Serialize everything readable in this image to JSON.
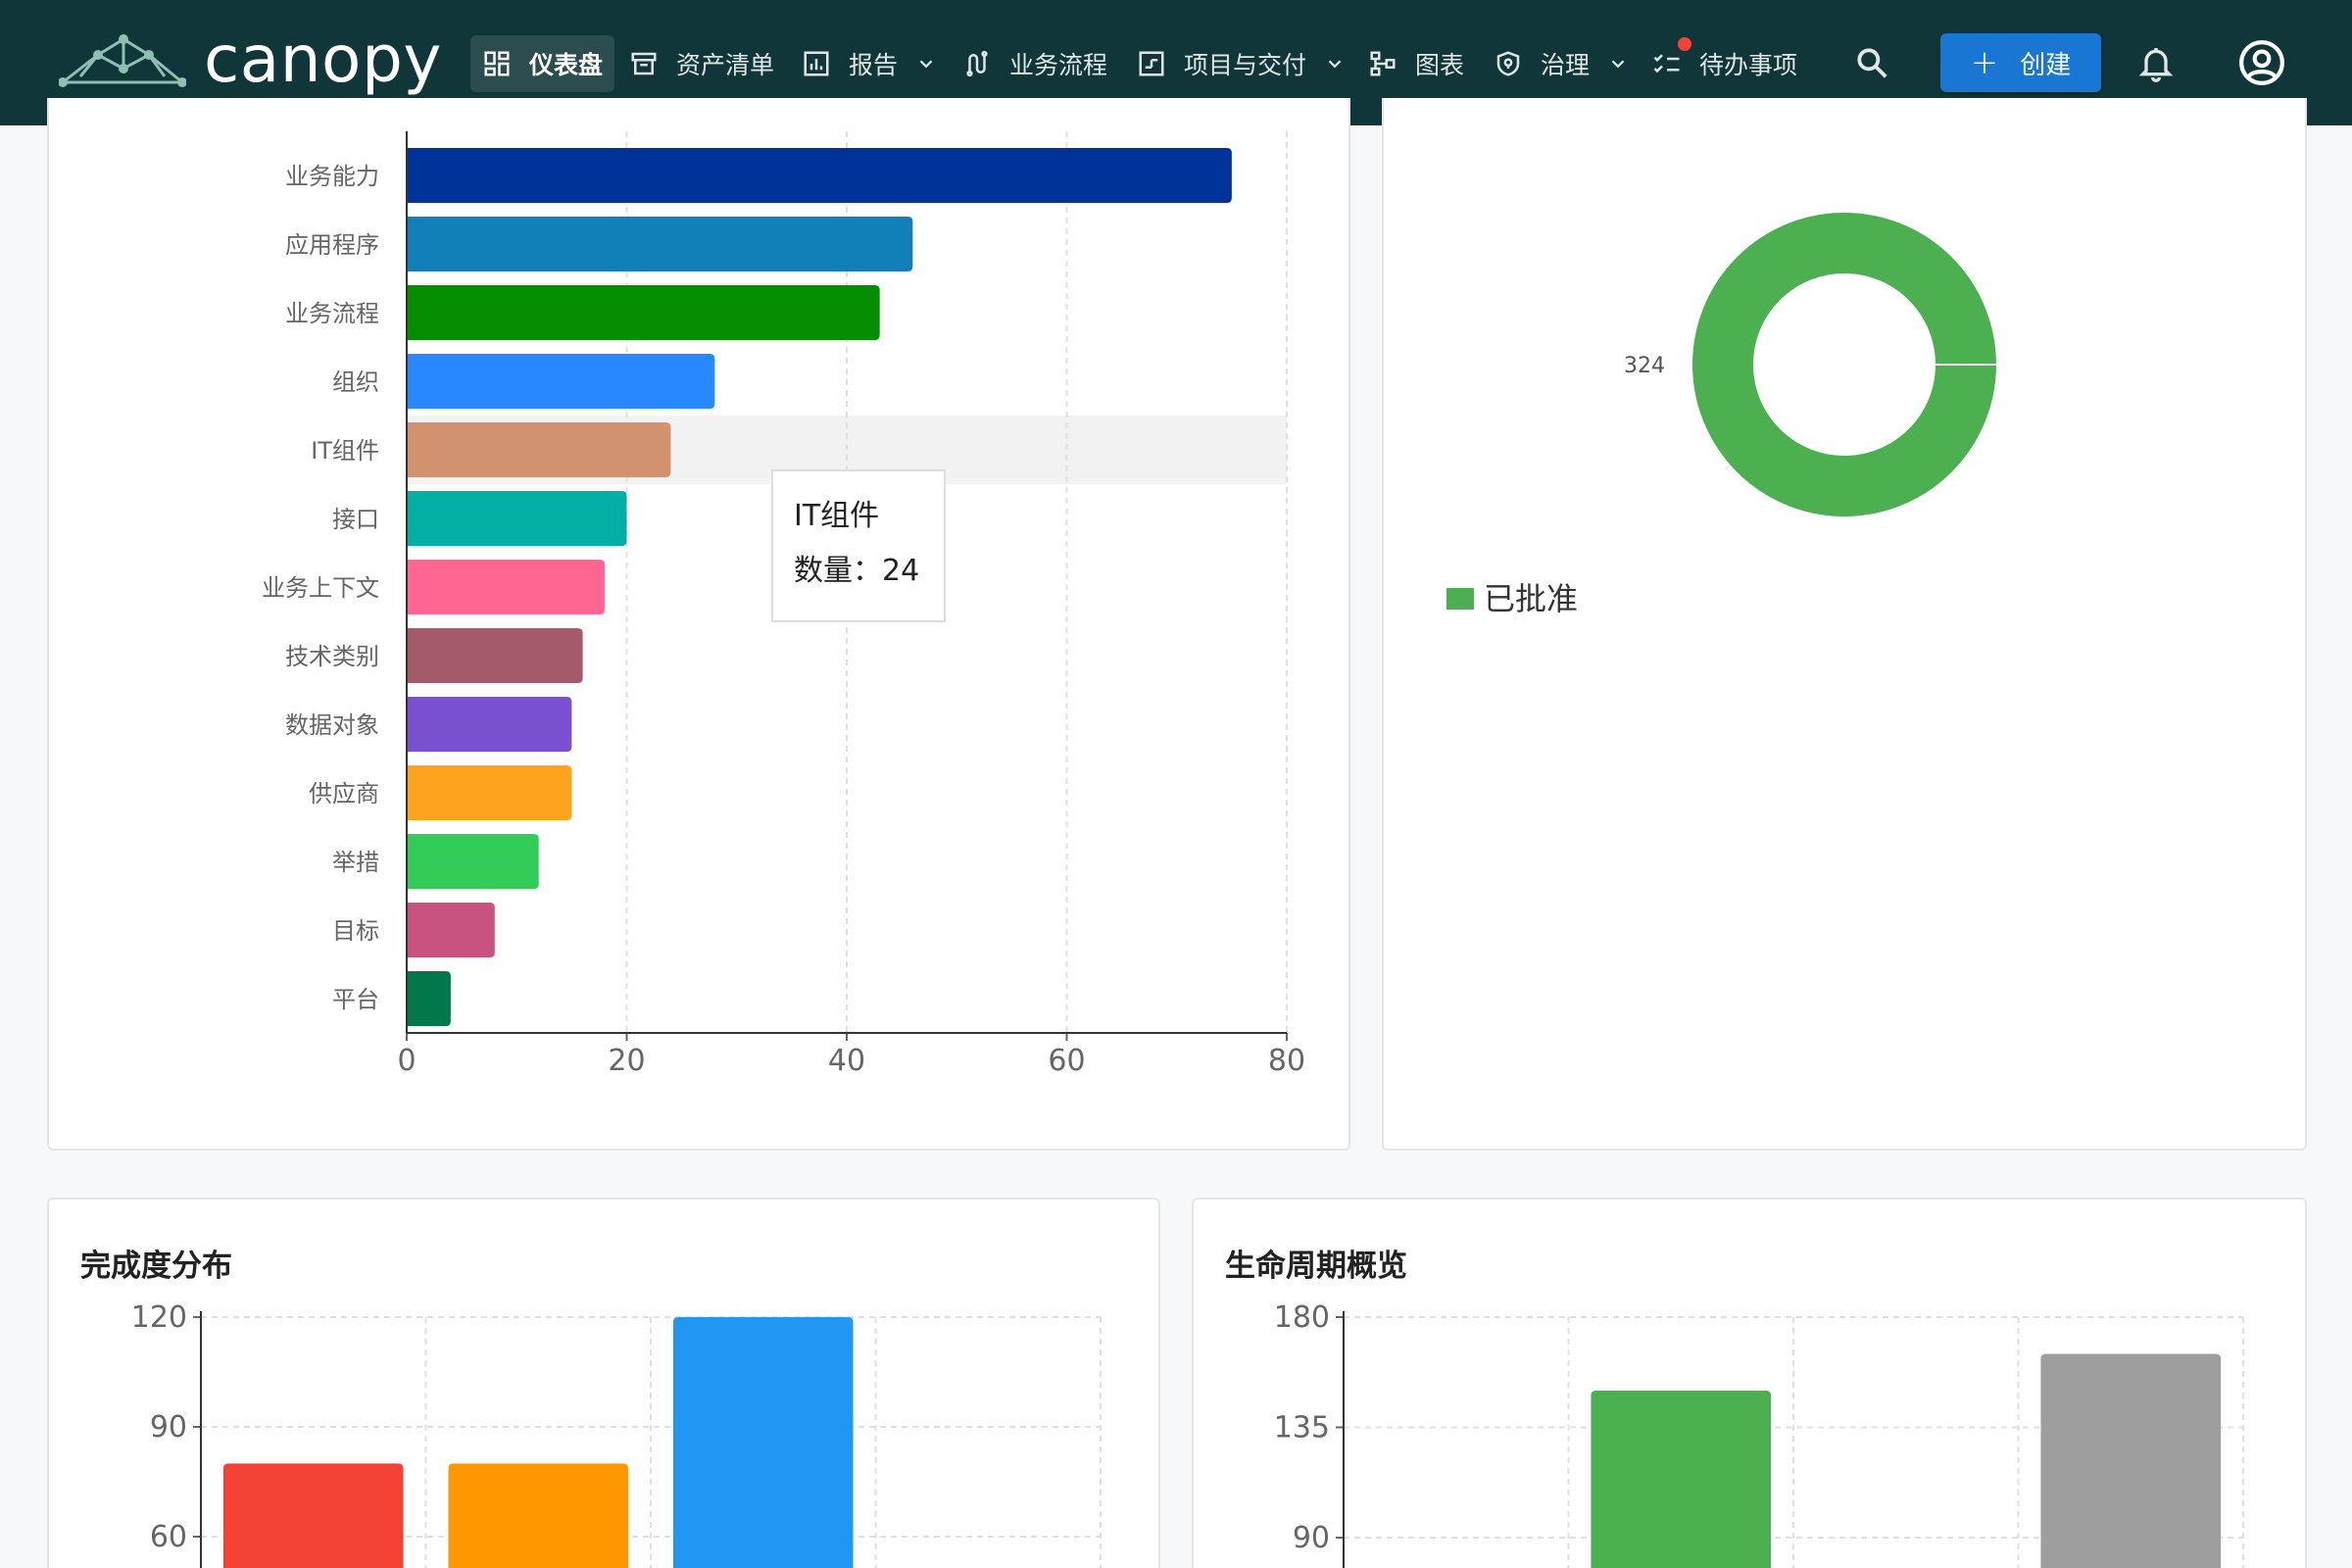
{
  "app": {
    "logo_text": "canopy"
  },
  "nav": {
    "items": [
      {
        "label": "仪表盘",
        "icon": "dashboard-icon"
      },
      {
        "label": "资产清单",
        "icon": "archive-icon"
      },
      {
        "label": "报告",
        "icon": "report-icon"
      },
      {
        "label": "业务流程",
        "icon": "process-icon"
      },
      {
        "label": "项目与交付",
        "icon": "project-icon"
      },
      {
        "label": "图表",
        "icon": "diagram-icon"
      },
      {
        "label": "治理",
        "icon": "shield-icon"
      },
      {
        "label": "待办事项",
        "icon": "checklist-icon"
      }
    ],
    "create_label": "创建"
  },
  "colors": {
    "topbar": "#113639",
    "accent": "#1976d2",
    "notification_dot": "#f44336"
  },
  "tooltip": {
    "title": "IT组件",
    "label": "数量：24"
  },
  "chart_data": [
    {
      "type": "bar",
      "orientation": "horizontal",
      "categories": [
        "业务能力",
        "应用程序",
        "业务流程",
        "组织",
        "IT组件",
        "接口",
        "业务上下文",
        "技术类别",
        "数据对象",
        "供应商",
        "举措",
        "目标",
        "平台"
      ],
      "values": [
        75,
        46,
        43,
        28,
        24,
        20,
        18,
        16,
        15,
        15,
        12,
        8,
        4
      ],
      "colors": [
        "#003399",
        "#1180b9",
        "#068e02",
        "#2889ff",
        "#d29270",
        "#02afa4",
        "#ff6692",
        "#a55a6b",
        "#7950cf",
        "#ffa31f",
        "#33cc58",
        "#c85280",
        "#02774c"
      ],
      "xlim": [
        0,
        80
      ],
      "xticks": [
        0,
        20,
        40,
        60,
        80
      ],
      "grid": true,
      "highlighted_category": "IT组件"
    },
    {
      "type": "pie",
      "style": "donut",
      "slices": [
        {
          "label": "已批准",
          "value": 324,
          "color": "#4caf50"
        }
      ],
      "data_label": "324",
      "legend": "bottom-left"
    },
    {
      "type": "bar",
      "title": "完成度分布",
      "values_visible": [
        80,
        80,
        120,
        50
      ],
      "colors": [
        "#f44336",
        "#ff9800",
        "#2196f3",
        "#4caf50"
      ],
      "yticks_visible": [
        60,
        90,
        120
      ],
      "ylim_visible": [
        45,
        120
      ],
      "grid": true
    },
    {
      "type": "bar",
      "title": "生命周期概览",
      "values_visible": [
        0,
        150,
        0,
        165
      ],
      "colors": [
        "#4caf50",
        "#4caf50",
        "#4caf50",
        "#9e9e9e"
      ],
      "yticks_visible": [
        90,
        135,
        180
      ],
      "ylim_visible": [
        68,
        180
      ],
      "grid": true
    }
  ]
}
